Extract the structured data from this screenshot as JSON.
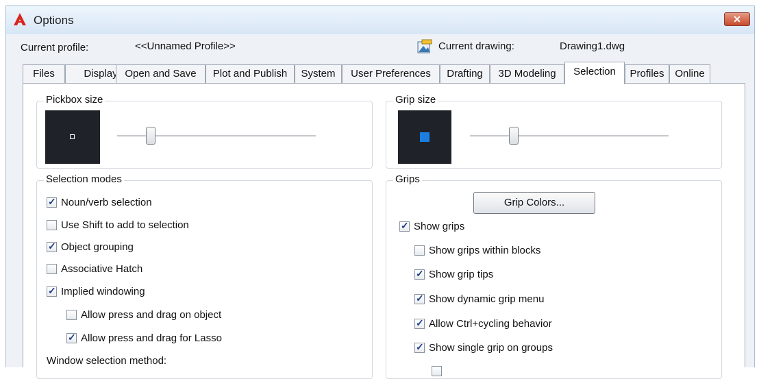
{
  "window": {
    "title": "Options",
    "close_glyph": "✕"
  },
  "header": {
    "current_profile_label": "Current profile:",
    "current_profile_value": "<<Unnamed Profile>>",
    "current_drawing_label": "Current drawing:",
    "current_drawing_value": "Drawing1.dwg"
  },
  "tabs": [
    {
      "label": "Files"
    },
    {
      "label": "Display"
    },
    {
      "label": "Open and Save"
    },
    {
      "label": "Plot and Publish"
    },
    {
      "label": "System"
    },
    {
      "label": "User Preferences"
    },
    {
      "label": "Drafting"
    },
    {
      "label": "3D Modeling"
    },
    {
      "label": "Selection",
      "active": true
    },
    {
      "label": "Profiles"
    },
    {
      "label": "Online"
    }
  ],
  "pickbox": {
    "title": "Pickbox size",
    "level": 0.17
  },
  "grip_size": {
    "title": "Grip size",
    "level": 0.22,
    "grip_color": "#1a7fe0"
  },
  "selection_modes": {
    "title": "Selection modes",
    "items": [
      {
        "label": "Noun/verb selection",
        "checked": true
      },
      {
        "label": "Use Shift to add to selection",
        "checked": false
      },
      {
        "label": "Object grouping",
        "checked": true
      },
      {
        "label": "Associative Hatch",
        "checked": false
      },
      {
        "label": "Implied windowing",
        "checked": true
      },
      {
        "label": "Allow press and drag on object",
        "checked": false
      },
      {
        "label": "Allow press and drag for Lasso",
        "checked": true
      }
    ],
    "window_method_label": "Window selection method:"
  },
  "grips": {
    "title": "Grips",
    "grip_colors_button": "Grip Colors...",
    "items": [
      {
        "label": "Show grips",
        "checked": true
      },
      {
        "label": "Show grips within blocks",
        "checked": false
      },
      {
        "label": "Show grip tips",
        "checked": true
      },
      {
        "label": "Show dynamic grip menu",
        "checked": true
      },
      {
        "label": "Allow Ctrl+cycling behavior",
        "checked": true
      },
      {
        "label": "Show single grip on groups",
        "checked": true
      }
    ]
  },
  "colors": {
    "accent_close": "#c74a2d",
    "app_icon": "#d9251c",
    "check_mark": "#1b3f8c"
  }
}
